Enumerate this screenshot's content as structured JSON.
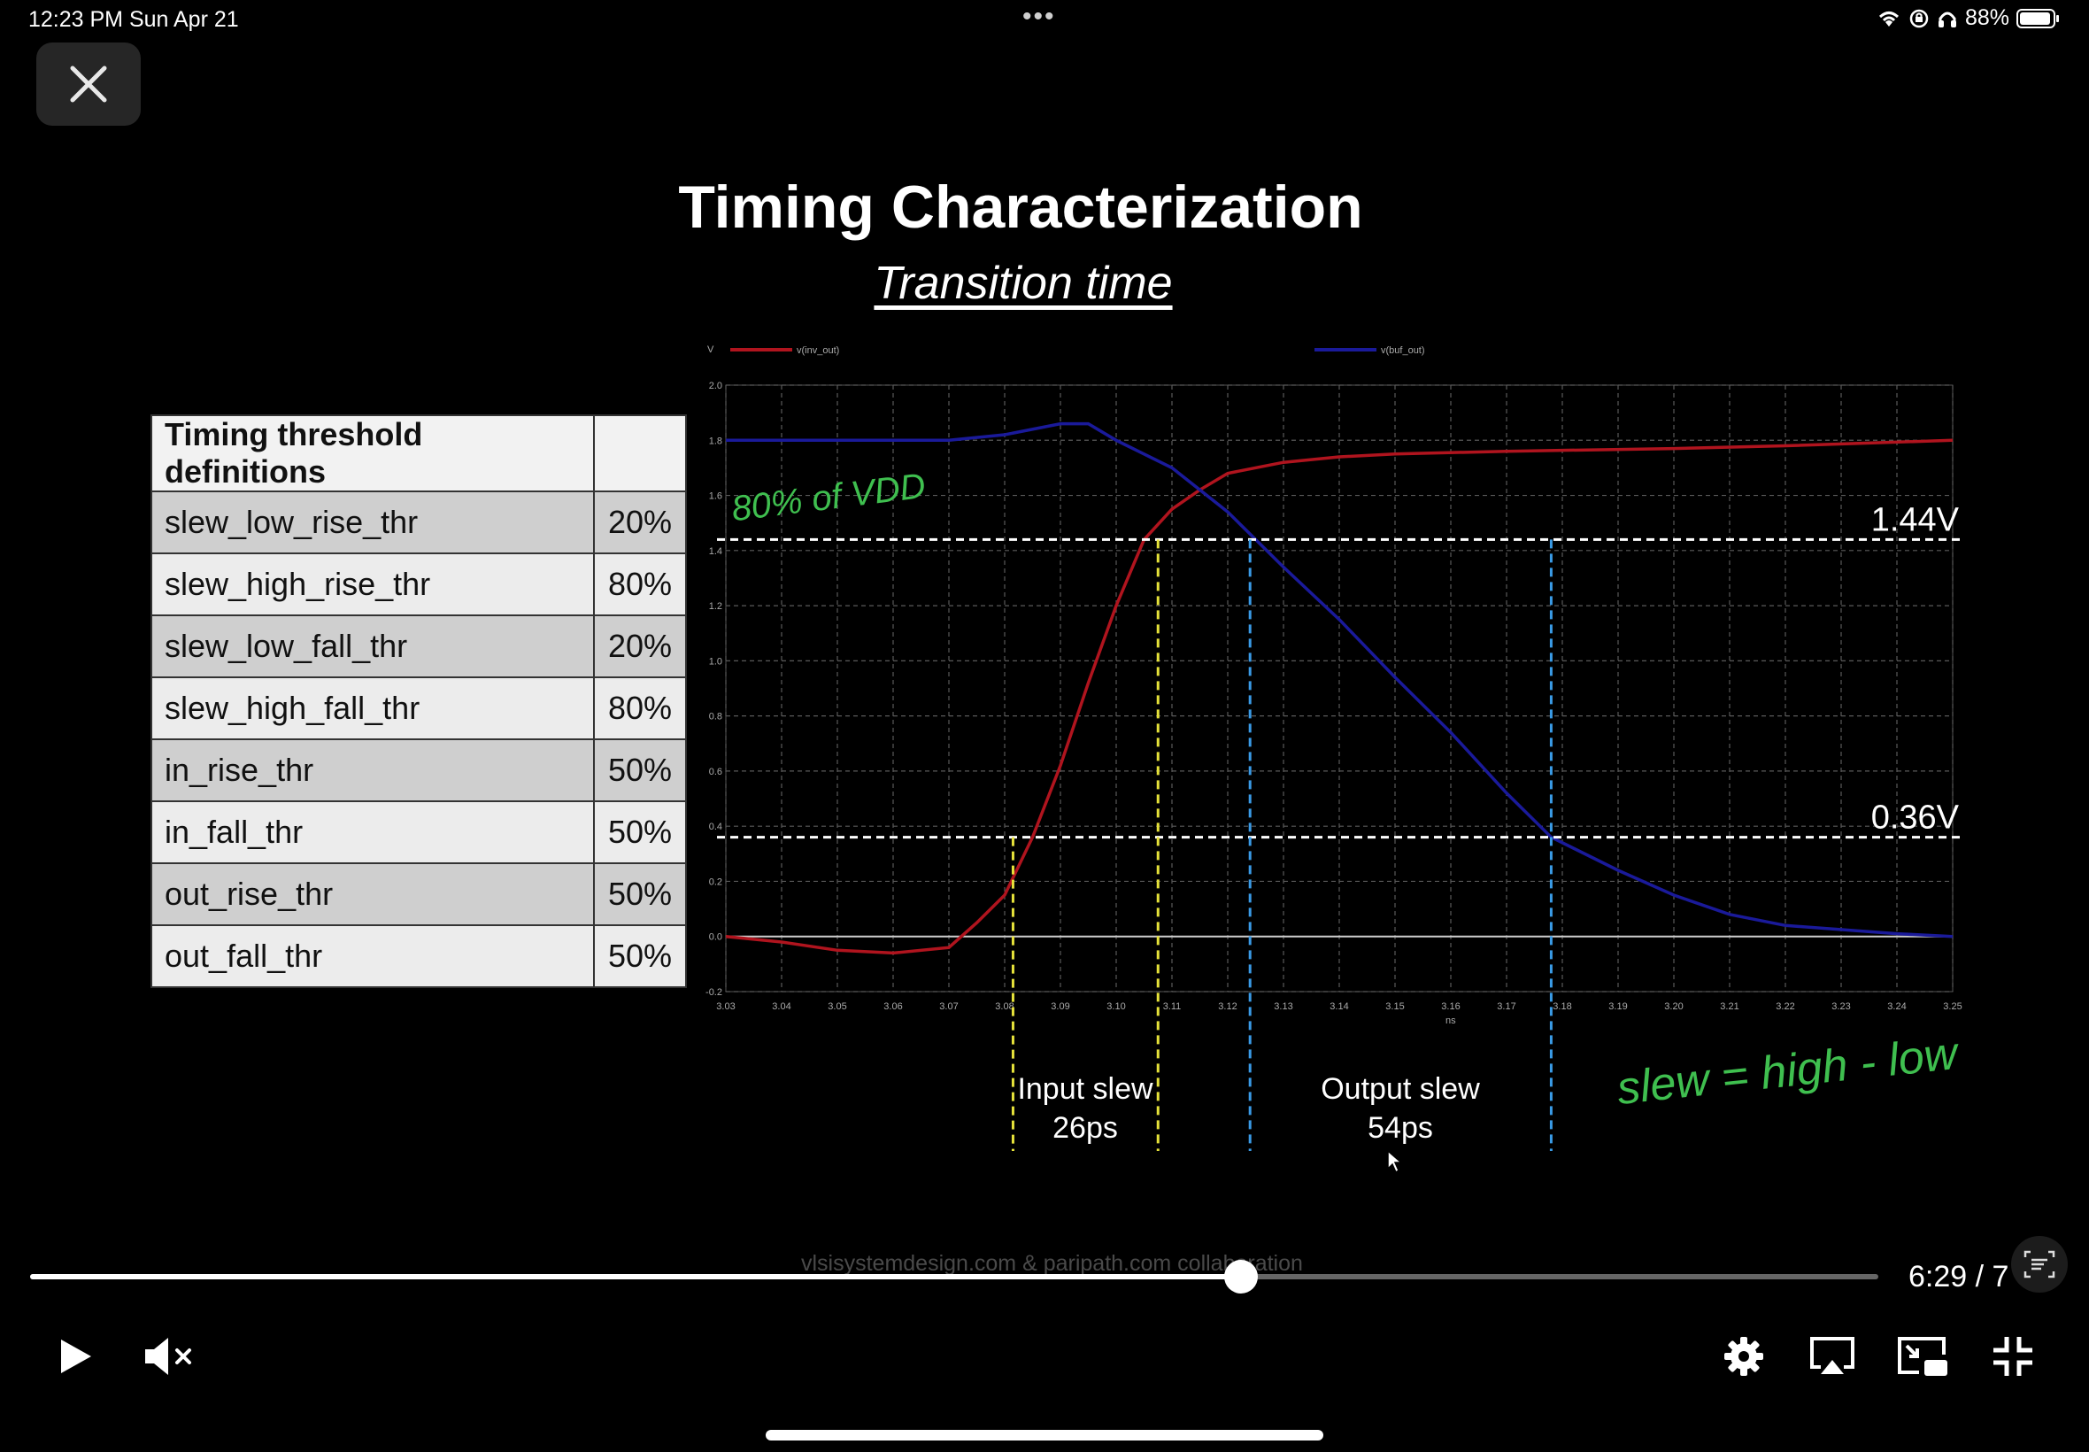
{
  "status_bar": {
    "time": "12:23 PM   Sun Apr 21",
    "battery": "88%",
    "icons": [
      "wifi-icon",
      "lock-rotation-icon",
      "headphones-icon",
      "battery-icon"
    ]
  },
  "player": {
    "close_icon": "close-icon",
    "time": "6:29 / 7",
    "progress_fraction": 0.655,
    "watermark": "vlsisystemdesign.com & paripath.com collaboration",
    "controls": [
      "play-icon",
      "mute-icon",
      "settings-icon",
      "airplay-icon",
      "picture-in-picture-icon",
      "exit-fullscreen-icon",
      "captions-icon"
    ]
  },
  "slide": {
    "title": "Timing Characterization",
    "subtitle": "Transition time",
    "table": {
      "header": "Timing threshold definitions",
      "header_value": "",
      "rows": [
        {
          "name": "slew_low_rise_thr",
          "value": "20%"
        },
        {
          "name": "slew_high_rise_thr",
          "value": "80%"
        },
        {
          "name": "slew_low_fall_thr",
          "value": "20%"
        },
        {
          "name": "slew_high_fall_thr",
          "value": "80%"
        },
        {
          "name": "in_rise_thr",
          "value": "50%"
        },
        {
          "name": "in_fall_thr",
          "value": "50%"
        },
        {
          "name": "out_rise_thr",
          "value": "50%"
        },
        {
          "name": "out_fall_thr",
          "value": "50%"
        }
      ]
    },
    "annotations": {
      "input_slew": [
        "Input slew",
        "26ps"
      ],
      "output_slew": [
        "Output slew",
        "54ps"
      ],
      "handwritten_vdd": "80% of VDD",
      "handwritten_formula": "slew = high - low"
    }
  },
  "colors": {
    "rise_curve": "#b0141e",
    "fall_curve": "#1a1a9a",
    "grid": "#5a5a5a",
    "handwriting": "#3fbf4f",
    "input_markers": "#e6e23a",
    "output_markers": "#3a9be6"
  },
  "chart_data": {
    "type": "line",
    "title": "",
    "xlabel": "ns",
    "ylabel": "V",
    "xlim": [
      3.03,
      3.25
    ],
    "ylim": [
      -0.2,
      2.0
    ],
    "x_ticks": [
      "3.03",
      "3.04",
      "3.05",
      "3.06",
      "3.07",
      "3.08",
      "3.09",
      "3.10",
      "3.11",
      "3.12",
      "3.13",
      "3.14",
      "3.15",
      "3.16",
      "3.17",
      "3.18",
      "3.19",
      "3.20",
      "3.21",
      "3.22",
      "3.23",
      "3.24",
      "3.25"
    ],
    "y_ticks": [
      "2.0",
      "1.8",
      "1.6",
      "1.4",
      "1.2",
      "1.0",
      "0.8",
      "0.6",
      "0.4",
      "0.2",
      "0.0",
      "-0.2"
    ],
    "grid": true,
    "legend_placement": "top",
    "series": [
      {
        "name": "v(inv_out)",
        "color": "#b0141e",
        "x": [
          3.03,
          3.04,
          3.05,
          3.06,
          3.07,
          3.075,
          3.08,
          3.085,
          3.09,
          3.095,
          3.1,
          3.105,
          3.11,
          3.115,
          3.12,
          3.13,
          3.14,
          3.15,
          3.17,
          3.2,
          3.22,
          3.25
        ],
        "y": [
          0.0,
          -0.02,
          -0.05,
          -0.06,
          -0.04,
          0.05,
          0.15,
          0.36,
          0.62,
          0.92,
          1.2,
          1.44,
          1.55,
          1.62,
          1.68,
          1.72,
          1.74,
          1.75,
          1.76,
          1.77,
          1.78,
          1.8
        ]
      },
      {
        "name": "v(buf_out)",
        "color": "#1a1a9a",
        "x": [
          3.03,
          3.05,
          3.07,
          3.08,
          3.09,
          3.095,
          3.1,
          3.11,
          3.12,
          3.125,
          3.13,
          3.14,
          3.15,
          3.16,
          3.17,
          3.178,
          3.19,
          3.2,
          3.21,
          3.22,
          3.24,
          3.25
        ],
        "y": [
          1.8,
          1.8,
          1.8,
          1.82,
          1.86,
          1.86,
          1.8,
          1.7,
          1.54,
          1.44,
          1.34,
          1.15,
          0.94,
          0.74,
          0.52,
          0.36,
          0.24,
          0.15,
          0.08,
          0.04,
          0.01,
          0.0
        ]
      }
    ],
    "reference_lines": [
      {
        "label": "1.44V",
        "y": 1.44
      },
      {
        "label": "0.36V",
        "y": 0.36
      }
    ],
    "markers": [
      {
        "x": 3.0815,
        "color": "#e6e23a"
      },
      {
        "x": 3.1075,
        "color": "#e6e23a"
      },
      {
        "x": 3.124,
        "color": "#3a9be6"
      },
      {
        "x": 3.178,
        "color": "#3a9be6"
      }
    ]
  }
}
